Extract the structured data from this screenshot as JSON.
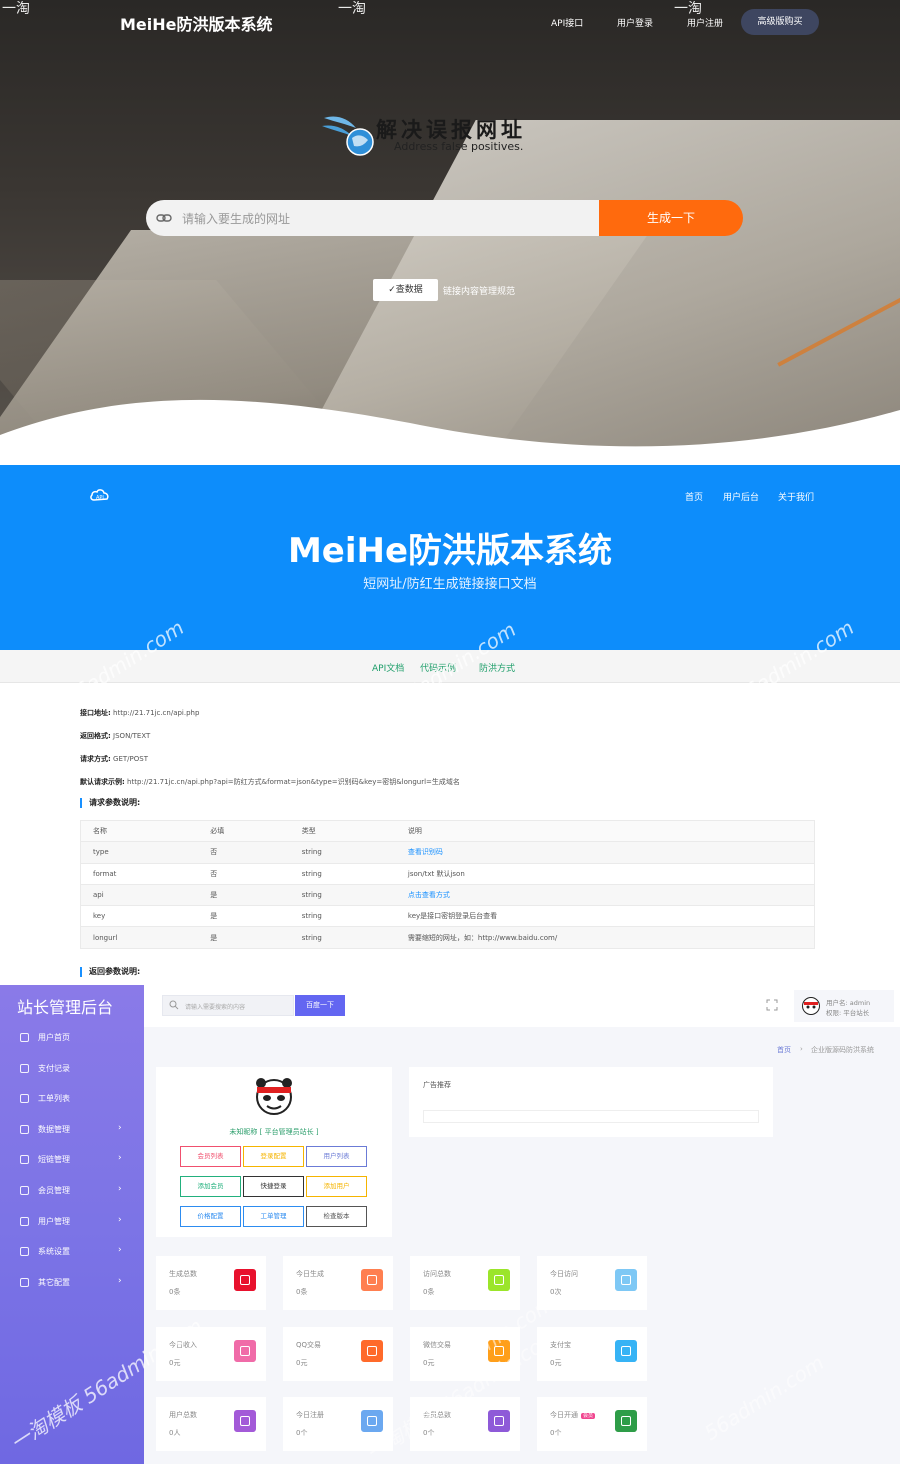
{
  "hero": {
    "title": "MeiHe防洪版本系统",
    "nav": [
      "API接口",
      "用户登录",
      "用户注册"
    ],
    "buy_label": "高级版购买",
    "watermark_top": [
      "一淘",
      "一淘",
      "一淘"
    ],
    "logo_text": "解决误报网址",
    "logo_sub": "Address false positives.",
    "input_placeholder": "请输入要生成的网址",
    "generate_label": "生成一下",
    "check_label": "✓查数据",
    "rule_link": "链接内容管理规范"
  },
  "api": {
    "nav": [
      "首页",
      "用户后台",
      "关于我们"
    ],
    "title": "MeiHe防洪版本系统",
    "subtitle": "短网址/防红生成链接接口文档",
    "tabs": [
      "API文档",
      "代码示例",
      "防洪方式"
    ],
    "info": [
      {
        "k": "接口地址:",
        "v": "http://21.71jc.cn/api.php"
      },
      {
        "k": "返回格式:",
        "v": "JSON/TEXT"
      },
      {
        "k": "请求方式:",
        "v": "GET/POST"
      },
      {
        "k": "默认请求示例:",
        "v": "http://21.71jc.cn/api.php?api=防红方式&format=json&type=识别码&key=密钥&longurl=生成域名"
      }
    ],
    "req_heading": "请求参数说明:",
    "resp_heading": "返回参数说明:",
    "table_headers": [
      "名称",
      "必填",
      "类型",
      "说明"
    ],
    "rows": [
      {
        "name": "type",
        "req": "否",
        "type": "string",
        "desc": "查看识别码",
        "link": true
      },
      {
        "name": "format",
        "req": "否",
        "type": "string",
        "desc": "json/txt 默认json",
        "link": false
      },
      {
        "name": "api",
        "req": "是",
        "type": "string",
        "desc": "点击查看方式",
        "link": true
      },
      {
        "name": "key",
        "req": "是",
        "type": "string",
        "desc": "key是接口密钥登录后台查看",
        "link": false
      },
      {
        "name": "longurl",
        "req": "是",
        "type": "string",
        "desc": "需要缩短的网址，如：http://www.baidu.com/",
        "link": false
      }
    ]
  },
  "admin": {
    "brand": "站长管理后台",
    "menu": [
      {
        "label": "用户首页",
        "arrow": false
      },
      {
        "label": "支付记录",
        "arrow": false
      },
      {
        "label": "工单列表",
        "arrow": false
      },
      {
        "label": "数据管理",
        "arrow": true
      },
      {
        "label": "短链管理",
        "arrow": true
      },
      {
        "label": "会员管理",
        "arrow": true
      },
      {
        "label": "用户管理",
        "arrow": true
      },
      {
        "label": "系统设置",
        "arrow": true
      },
      {
        "label": "其它配置",
        "arrow": true
      }
    ],
    "arrow": "›",
    "search_placeholder": "请输入需要搜索的内容",
    "search_button": "百度一下",
    "username": "用户名: admin",
    "role": "权限: 平台站长",
    "breadcrumb": [
      "首页",
      "›",
      "企业版源码防洪系统"
    ],
    "nickname": "未知昵称 [ 平台管理员站长 ]",
    "quick_buttons": [
      {
        "label": "会员列表",
        "color": "#f0506e"
      },
      {
        "label": "登录配置",
        "color": "#f5b400"
      },
      {
        "label": "用户列表",
        "color": "#6b7bd6"
      },
      {
        "label": "添加会员",
        "color": "#22b07d"
      },
      {
        "label": "快捷登录",
        "color": "#333333"
      },
      {
        "label": "添加用户",
        "color": "#f5b400"
      },
      {
        "label": "价格配置",
        "color": "#2d8cf0"
      },
      {
        "label": "工单管理",
        "color": "#2d8cf0"
      },
      {
        "label": "检查版本",
        "color": "#555555"
      }
    ],
    "ad_title": "广告推荐",
    "stats": [
      {
        "label": "生成总数",
        "value": "0条",
        "color": "#e8112d"
      },
      {
        "label": "今日生成",
        "value": "0条",
        "color": "#ff7f50"
      },
      {
        "label": "访问总数",
        "value": "0条",
        "color": "#9be52a"
      },
      {
        "label": "今日访问",
        "value": "0次",
        "color": "#7ec8f5"
      },
      {
        "label": "今日收入",
        "value": "0元",
        "color": "#f06ba8"
      },
      {
        "label": "QQ交易",
        "value": "0元",
        "color": "#ff6a2a"
      },
      {
        "label": "微信交易",
        "value": "0元",
        "color": "#ff9f1a"
      },
      {
        "label": "支付宝",
        "value": "0元",
        "color": "#36b3f5"
      },
      {
        "label": "用户总数",
        "value": "0人",
        "color": "#a35ad8"
      },
      {
        "label": "今日注册",
        "value": "0个",
        "color": "#6ba8f0"
      },
      {
        "label": "会员总数",
        "value": "0个",
        "color": "#8e5ad8"
      },
      {
        "label": "今日开通",
        "value": "0个",
        "color": "#2e9d48",
        "tag": "会员"
      }
    ]
  },
  "watermarks": [
    "56admin.com",
    "56admin.com",
    "56admin.com",
    "一淘模板 56admin.com",
    "56admin.com",
    "一淘模板 56admin.com",
    "56admin.com"
  ]
}
